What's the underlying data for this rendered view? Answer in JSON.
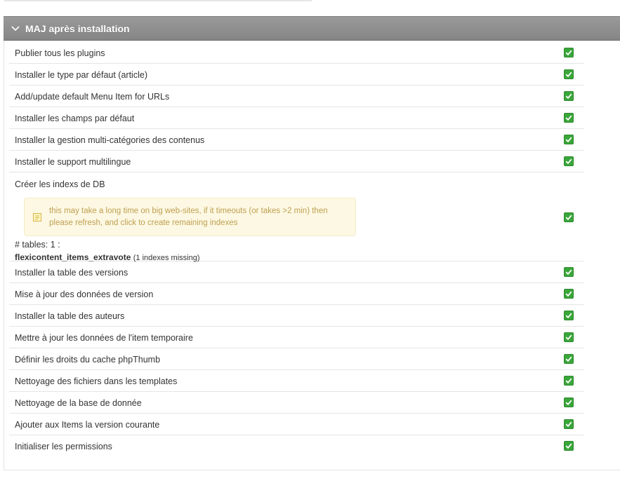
{
  "panel": {
    "title": "MAJ après installation"
  },
  "tasks_before": [
    {
      "label": "Publier tous les plugins",
      "status": "ok"
    },
    {
      "label": "Installer le type par défaut (article)",
      "status": "ok"
    },
    {
      "label": "Add/update default Menu Item for URLs",
      "status": "ok"
    },
    {
      "label": "Installer les champs par défaut",
      "status": "ok"
    },
    {
      "label": "Installer la gestion multi-catégories des contenus",
      "status": "ok"
    },
    {
      "label": "Installer le support multilingue",
      "status": "ok"
    }
  ],
  "db_task": {
    "label": "Créer les indexs de DB",
    "notice": "this may take a long time on big web-sites, if it timeouts (or takes >2 min) then please refresh, and click to create remaining indexes",
    "tables_label": "# tables: 1 :",
    "table_name": "flexicontent_items_extravote",
    "missing_note": "(1 indexes missing)",
    "status": "ok"
  },
  "tasks_after": [
    {
      "label": "Installer la table des versions",
      "status": "ok"
    },
    {
      "label": "Mise à jour des données de version",
      "status": "ok"
    },
    {
      "label": "Installer la table des auteurs",
      "status": "ok"
    },
    {
      "label": "Mettre à jour les données de l'item temporaire",
      "status": "ok"
    },
    {
      "label": "Définir les droits du cache phpThumb",
      "status": "ok"
    },
    {
      "label": "Nettoyage des fichiers dans les templates",
      "status": "ok"
    },
    {
      "label": "Nettoyage de la base de donnée",
      "status": "ok"
    },
    {
      "label": "Ajouter aux Items la version courante",
      "status": "ok"
    },
    {
      "label": "Initialiser les permissions",
      "status": "ok"
    }
  ],
  "colors": {
    "check_green": "#3aa63a",
    "header_gray": "#8e8e8e",
    "notice_bg": "#fcf8e3",
    "notice_text": "#c0a051"
  },
  "icons": {
    "header": "chevron-down-icon",
    "status_ok": "check-icon",
    "notice": "note-icon"
  }
}
